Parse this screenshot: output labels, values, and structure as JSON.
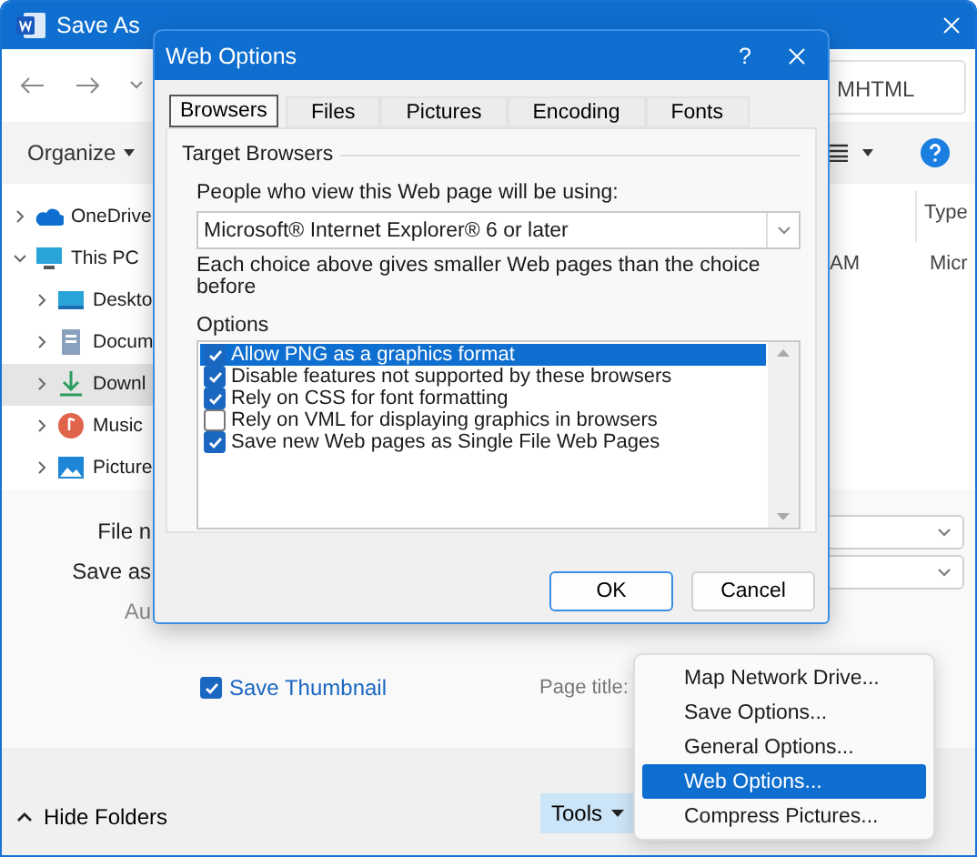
{
  "save_as": {
    "title": "Save As",
    "address": "MHTML",
    "organize": "Organize",
    "nav": [
      {
        "label": "OneDrive",
        "kind": "cloud",
        "expanded": false,
        "selected": false
      },
      {
        "label": "This PC",
        "kind": "pc",
        "expanded": true,
        "selected": false,
        "children": [
          {
            "label": "Deskto",
            "kind": "desktop",
            "expanded": false,
            "selected": false
          },
          {
            "label": "Docum",
            "kind": "documents",
            "expanded": false,
            "selected": false
          },
          {
            "label": "Downl",
            "kind": "downloads",
            "expanded": false,
            "selected": true
          },
          {
            "label": "Music",
            "kind": "music",
            "expanded": false,
            "selected": false
          },
          {
            "label": "Picture",
            "kind": "pictures",
            "expanded": false,
            "selected": false
          }
        ]
      }
    ],
    "file_list": {
      "column_header": "Type",
      "row": [
        "AM",
        "Micr"
      ]
    },
    "form": {
      "labels": [
        {
          "text": "File n",
          "disabled": false
        },
        {
          "text": "Save as",
          "disabled": false
        },
        {
          "text": "Au",
          "disabled": true
        }
      ],
      "save_thumbnail": {
        "label": "Save Thumbnail",
        "checked": true
      },
      "page_title_label": "Page title:"
    },
    "footer": {
      "hide_folders": "Hide Folders",
      "tools": "Tools"
    }
  },
  "dialog": {
    "title": "Web Options",
    "help": "?",
    "tabs": [
      {
        "label": "Browsers",
        "selected": true
      },
      {
        "label": "Files",
        "selected": false
      },
      {
        "label": "Pictures",
        "selected": false
      },
      {
        "label": "Encoding",
        "selected": false
      },
      {
        "label": "Fonts",
        "selected": false
      }
    ],
    "group": "Target Browsers",
    "prompt": "People who view this Web page will be using:",
    "browser": "Microsoft® Internet Explorer® 6 or later",
    "note": "Each choice above gives smaller Web pages than the choice before",
    "options_label": "Options",
    "options": [
      {
        "label": "Allow PNG as a graphics format",
        "checked": true,
        "selected": true
      },
      {
        "label": "Disable features not supported by these browsers",
        "checked": true,
        "selected": false
      },
      {
        "label": "Rely on CSS for font formatting",
        "checked": true,
        "selected": false
      },
      {
        "label": "Rely on VML for displaying graphics in browsers",
        "checked": false,
        "selected": false
      },
      {
        "label": "Save new Web pages as Single File Web Pages",
        "checked": true,
        "selected": false
      }
    ],
    "buttons": [
      {
        "label": "OK",
        "selected": true
      },
      {
        "label": "Cancel",
        "selected": false
      }
    ]
  },
  "menu": [
    {
      "label": "Map Network Drive...",
      "selected": false
    },
    {
      "label": "Save Options...",
      "selected": false
    },
    {
      "label": "General Options...",
      "selected": false
    },
    {
      "label": "Web Options...",
      "selected": true
    },
    {
      "label": "Compress Pictures...",
      "selected": false
    }
  ]
}
